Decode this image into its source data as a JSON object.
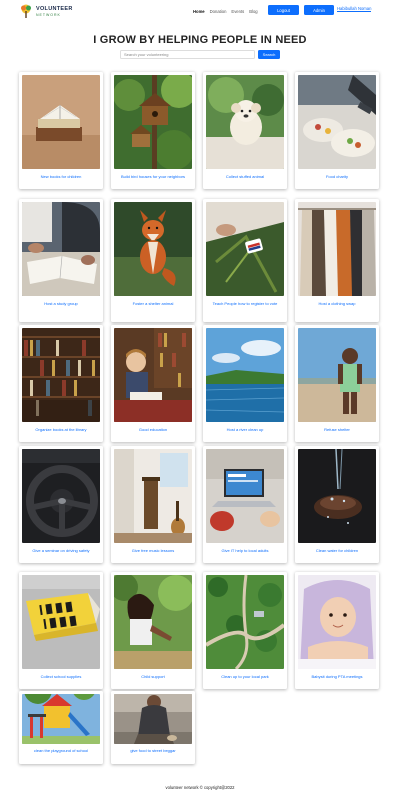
{
  "nav": {
    "logo_text": "VOLUNTEER",
    "logo_sub": "NETWORK",
    "links": [
      "Home",
      "Donation",
      "Events",
      "Blog"
    ],
    "logout_label": "Logout",
    "admin_label": "Admin",
    "user_name": "Habibullah Noman"
  },
  "headline": "I GROW BY HELPING PEOPLE IN NEED",
  "search": {
    "placeholder": "Search your volunteering",
    "button_label": "Search"
  },
  "cards": [
    {
      "title": "New books for children",
      "image": "books-photo"
    },
    {
      "title": "Build bird houses for your neighbors",
      "image": "birdhouse-photo"
    },
    {
      "title": "Collect stuffed animal",
      "image": "stuffed-animal-photo"
    },
    {
      "title": "Food charity",
      "image": "food-charity-photo"
    },
    {
      "title": "Host a study group",
      "image": "study-group-photo"
    },
    {
      "title": "Foster a shelter animal",
      "image": "fox-photo"
    },
    {
      "title": "Teach People how to register to vote",
      "image": "vote-photo"
    },
    {
      "title": "Host a clothing swap",
      "image": "clothing-photo"
    },
    {
      "title": "Organize books at the library",
      "image": "library-photo"
    },
    {
      "title": "Good education",
      "image": "education-photo"
    },
    {
      "title": "Host a river clean up",
      "image": "river-photo"
    },
    {
      "title": "Refuse shelter",
      "image": "child-photo"
    },
    {
      "title": "Give a seminar on driving safety",
      "image": "steering-wheel-photo"
    },
    {
      "title": "Give free music lessons",
      "image": "music-photo"
    },
    {
      "title": "Give IT help to local adults",
      "image": "laptop-photo"
    },
    {
      "title": "Clean water for children",
      "image": "water-hands-photo"
    },
    {
      "title": "Collect school supplies",
      "image": "love-to-learn-photo"
    },
    {
      "title": "Child support",
      "image": "girl-outdoors-photo"
    },
    {
      "title": "Clean up to your local park",
      "image": "park-photo"
    },
    {
      "title": "Babysit during PTA meetings",
      "image": "baby-photo"
    },
    {
      "title": "clean the playground of school",
      "image": "playground-photo"
    },
    {
      "title": "give food to street beggar",
      "image": "beggar-photo"
    }
  ],
  "footer": "volunteer network © copyright@2022",
  "colors": {
    "accent": "#0d6efd",
    "logo_green": "#2a7a3a"
  }
}
